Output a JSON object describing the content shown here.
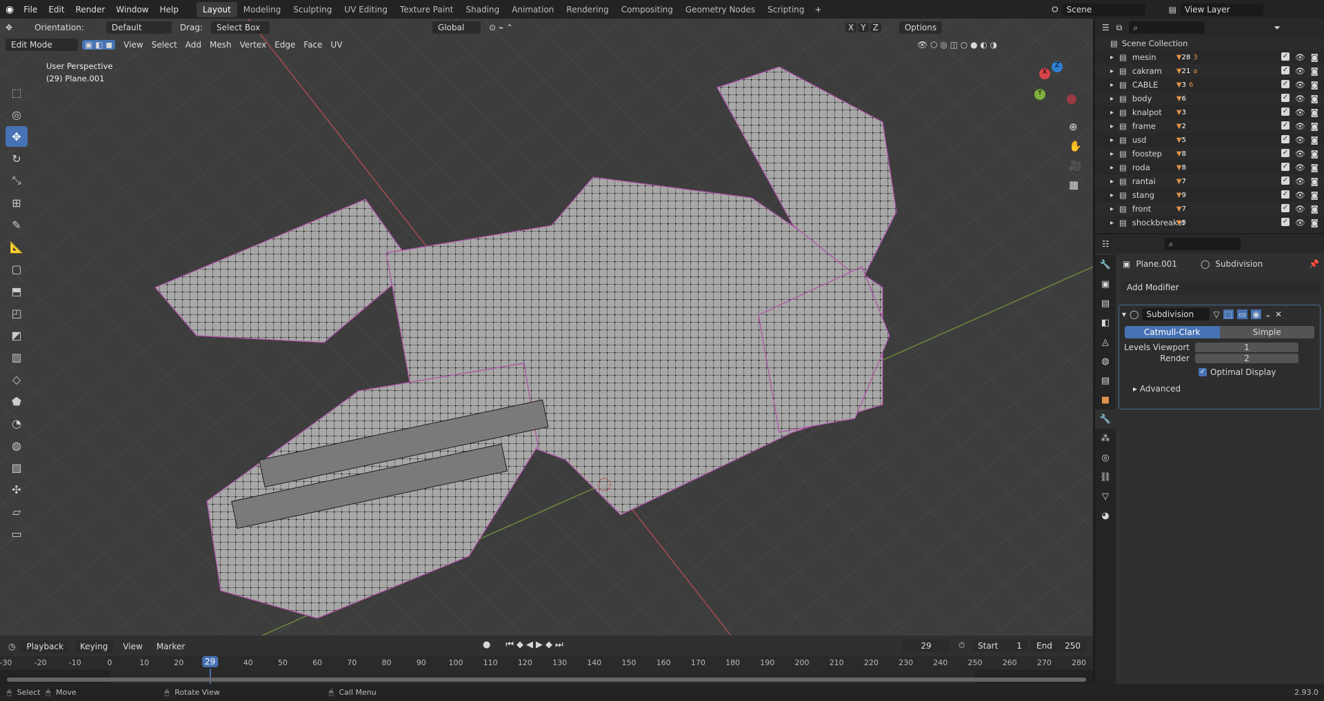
{
  "topbar": {
    "menus": [
      "File",
      "Edit",
      "Render",
      "Window",
      "Help"
    ],
    "workspaces": [
      "Layout",
      "Modeling",
      "Sculpting",
      "UV Editing",
      "Texture Paint",
      "Shading",
      "Animation",
      "Rendering",
      "Compositing",
      "Geometry Nodes",
      "Scripting"
    ],
    "active_workspace": "Layout",
    "scene": "Scene",
    "view_layer": "View Layer"
  },
  "viewport": {
    "orientation_label": "Orientation:",
    "orientation": "Default",
    "drag_label": "Drag:",
    "drag": "Select Box",
    "transform": "Global",
    "options": "Options",
    "mode": "Edit Mode",
    "menus": [
      "View",
      "Select",
      "Add",
      "Mesh",
      "Vertex",
      "Edge",
      "Face",
      "UV"
    ],
    "overlay_title": "User Perspective",
    "overlay_object": "(29) Plane.001",
    "axis_labels": [
      "X",
      "Y",
      "Z"
    ]
  },
  "outliner": {
    "root": "Scene Collection",
    "items": [
      {
        "name": "mesin",
        "count": "28",
        "extra": "3"
      },
      {
        "name": "cakram",
        "count": "21",
        "extra": "a"
      },
      {
        "name": "CABLE",
        "count": "3",
        "extra": "6"
      },
      {
        "name": "body",
        "count": "6"
      },
      {
        "name": "knalpot",
        "count": "3"
      },
      {
        "name": "frame",
        "count": "2"
      },
      {
        "name": "usd",
        "count": "5"
      },
      {
        "name": "foostep",
        "count": "8"
      },
      {
        "name": "roda",
        "count": "8"
      },
      {
        "name": "rantai",
        "count": "7"
      },
      {
        "name": "stang",
        "count": "9"
      },
      {
        "name": "front",
        "count": "7"
      },
      {
        "name": "shockbreaker",
        "count": "5"
      }
    ]
  },
  "properties": {
    "object": "Plane.001",
    "modifier_crumb": "Subdivision",
    "add_modifier": "Add Modifier",
    "modifier_name": "Subdivision",
    "types": [
      "Catmull-Clark",
      "Simple"
    ],
    "levels_label": "Levels Viewport",
    "levels": "1",
    "render_label": "Render",
    "render": "2",
    "optimal": "Optimal Display",
    "advanced": "Advanced"
  },
  "timeline": {
    "menus": [
      "Playback",
      "Keying",
      "View",
      "Marker"
    ],
    "current_frame": "29",
    "start_label": "Start",
    "start": "1",
    "end_label": "End",
    "end": "250",
    "ticks": [
      "-30",
      "-20",
      "-10",
      "0",
      "10",
      "20",
      "40",
      "50",
      "60",
      "70",
      "80",
      "90",
      "100",
      "110",
      "120",
      "130",
      "140",
      "150",
      "160",
      "170",
      "180",
      "190",
      "200",
      "210",
      "220",
      "230",
      "240",
      "250",
      "260",
      "270",
      "280"
    ]
  },
  "status": {
    "select": "Select",
    "move": "Move",
    "rotate": "Rotate View",
    "menu": "Call Menu",
    "version": "2.93.0"
  },
  "colors": {
    "accent": "#4772b3",
    "object": "#e0924a",
    "x_axis": "#e0474f",
    "y_axis": "#7fb03a"
  }
}
